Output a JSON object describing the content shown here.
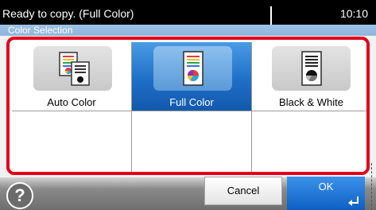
{
  "status": {
    "message": "Ready to copy. (Full Color)",
    "time": "10:10"
  },
  "section": {
    "title": "Color Selection"
  },
  "options": [
    {
      "label": "Auto Color",
      "icon": "auto-color-icon",
      "selected": false
    },
    {
      "label": "Full Color",
      "icon": "full-color-icon",
      "selected": true
    },
    {
      "label": "Black & White",
      "icon": "black-and-white-icon",
      "selected": false
    }
  ],
  "footer": {
    "help_label": "?",
    "cancel_label": "Cancel",
    "ok_label": "OK"
  },
  "colors": {
    "highlight": "#e3001b",
    "selected": "#1f6fc7",
    "status_bar": "#000000",
    "header": "#9ec3e6"
  }
}
